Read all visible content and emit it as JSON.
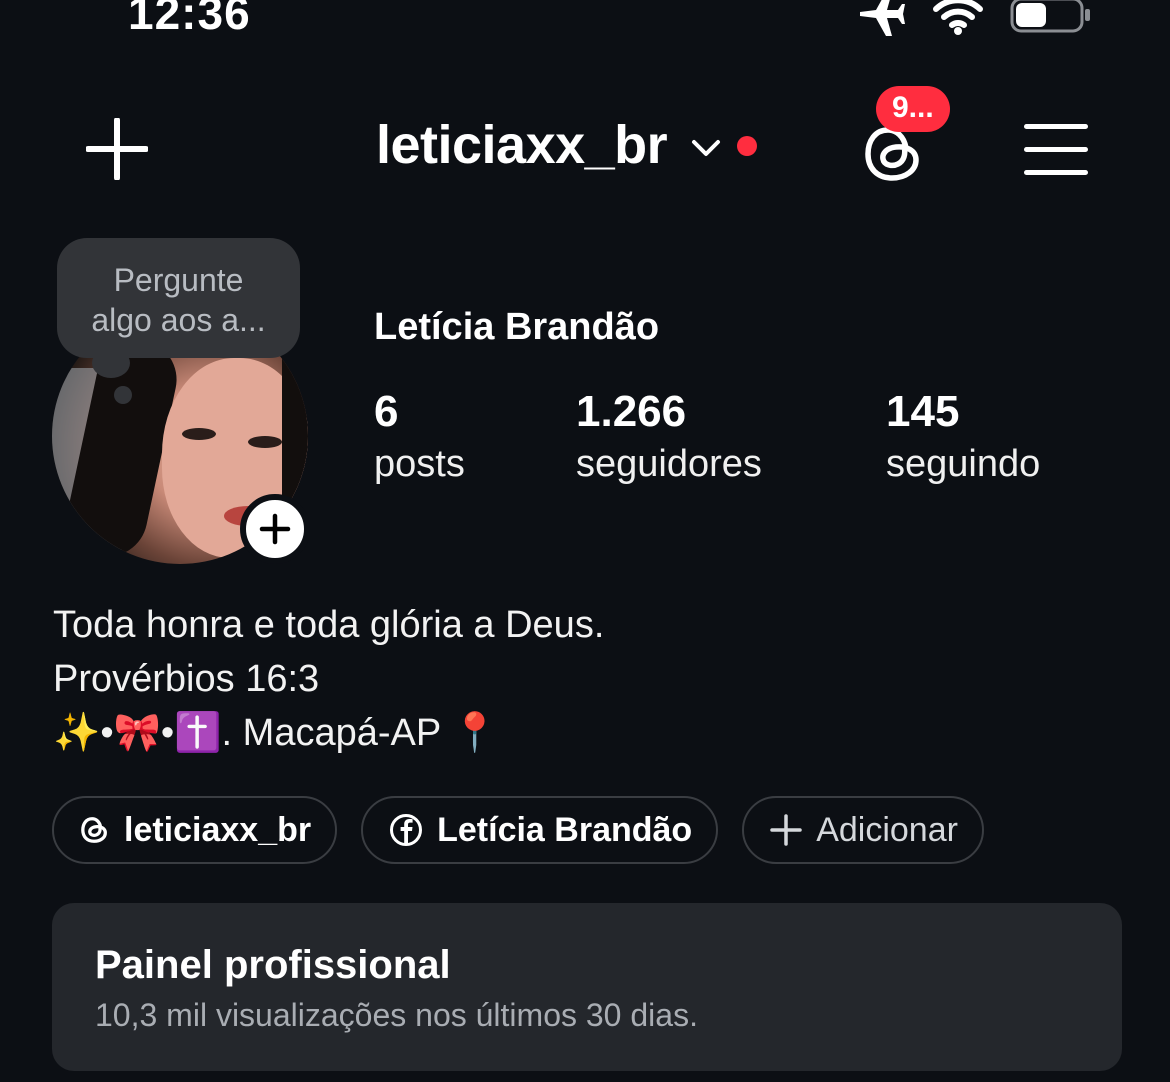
{
  "status_bar": {
    "time": "12:36",
    "icons": [
      "airplane-icon",
      "wifi-icon",
      "battery-icon"
    ]
  },
  "header": {
    "username": "leticiaxx_br",
    "notification_badge": "9...",
    "icons": [
      "plus-icon",
      "chevron-down-icon",
      "threads-icon",
      "menu-icon"
    ],
    "accent_color": "#ff2d3f"
  },
  "note": {
    "line1": "Pergunte",
    "line2": "algo aos a..."
  },
  "profile": {
    "display_name": "Letícia Brandão",
    "stats": [
      {
        "value": "6",
        "label": "posts"
      },
      {
        "value": "1.266",
        "label": "seguidores"
      },
      {
        "value": "145",
        "label": "seguindo"
      }
    ]
  },
  "bio": {
    "line1": "Toda honra e toda glória a Deus.",
    "line2": "Provérbios 16:3",
    "line3_prefix": "✨•🎀•✝️. ",
    "line3_text": "Macapá-AP 📍"
  },
  "links": [
    {
      "icon": "threads-icon",
      "label": "leticiaxx_br"
    },
    {
      "icon": "facebook-icon",
      "label": "Letícia Brandão"
    },
    {
      "icon": "plus-icon",
      "label": "Adicionar"
    }
  ],
  "panel": {
    "title": "Painel profissional",
    "subtitle": "10,3 mil visualizações nos últimos 30 dias."
  }
}
